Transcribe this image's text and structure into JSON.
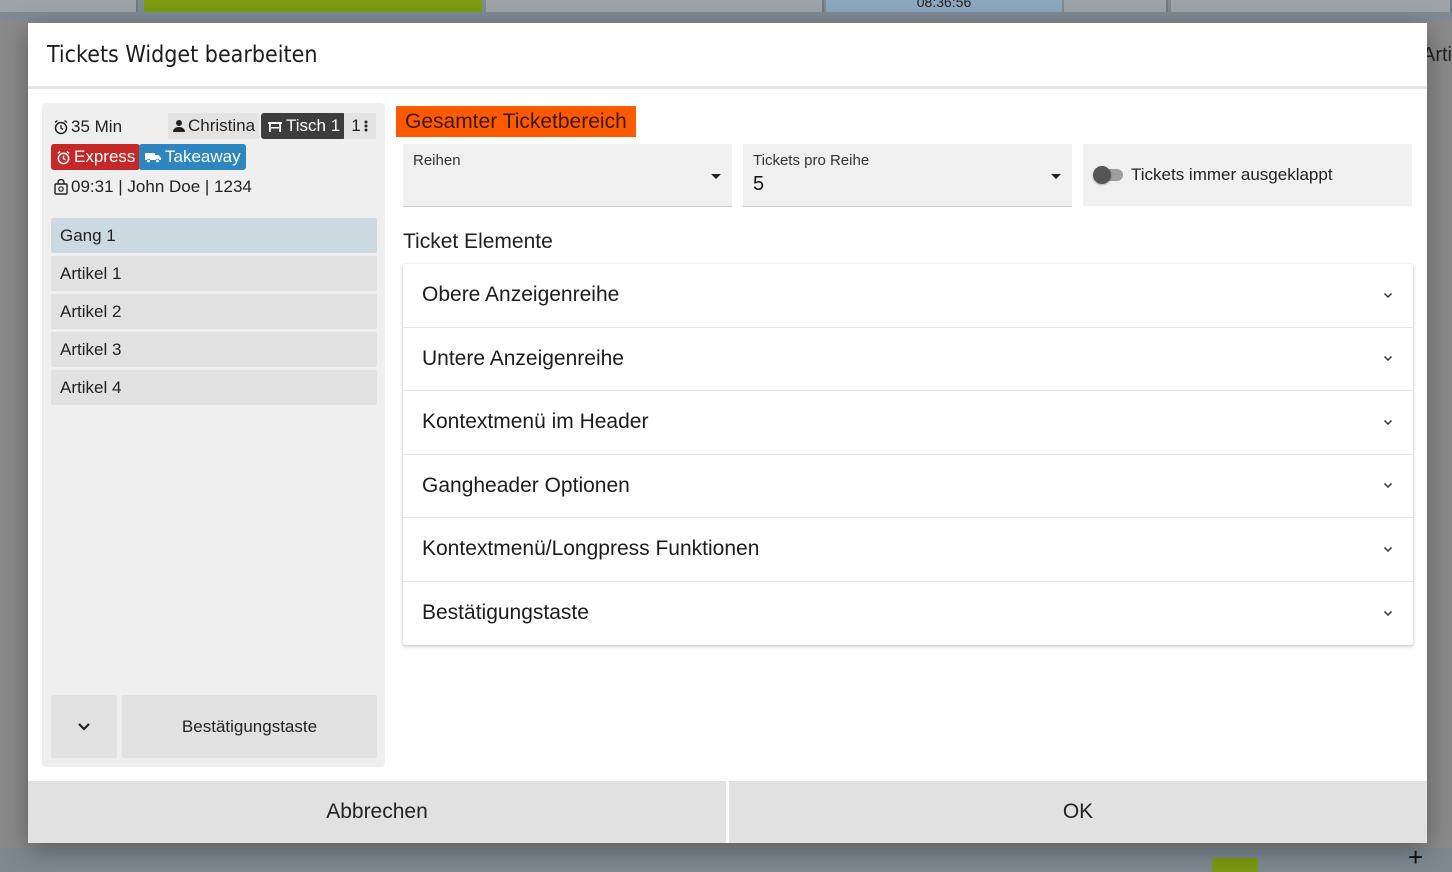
{
  "background": {
    "clock": "08:36:56",
    "right_label": "Arti",
    "plus": "+"
  },
  "dialog": {
    "title": "Tickets Widget bearbeiten"
  },
  "preview": {
    "timer": "35 Min",
    "user": "Christina",
    "table": "Tisch 1",
    "count": "1",
    "badge_express": "Express",
    "badge_takeaway": "Takeaway",
    "order_info": "09:31 | John Doe | 1234",
    "courses": [
      {
        "label": "Gang 1",
        "type": "head"
      },
      {
        "label": "Artikel 1",
        "type": "item"
      },
      {
        "label": "Artikel 2",
        "type": "item"
      },
      {
        "label": "Artikel 3",
        "type": "item"
      },
      {
        "label": "Artikel 4",
        "type": "item"
      }
    ],
    "confirm_button": "Bestätigungstaste"
  },
  "settings": {
    "section_tag": "Gesamter Ticketbereich",
    "rows_field": {
      "label": "Reihen",
      "value": ""
    },
    "per_row_field": {
      "label": "Tickets pro Reihe",
      "value": "5"
    },
    "toggle_label": "Tickets immer ausgeklappt",
    "toggle_on": false,
    "elements_title": "Ticket Elemente",
    "accordion": [
      "Obere Anzeigenreihe",
      "Untere Anzeigenreihe",
      "Kontextmenü im Header",
      "Gangheader Optionen",
      "Kontextmenü/Longpress Funktionen",
      "Bestätigungstaste"
    ]
  },
  "footer": {
    "cancel": "Abbrechen",
    "ok": "OK"
  },
  "colors": {
    "section_tag": "#ff5a00",
    "express": "#c62828",
    "takeaway": "#2e86c1",
    "table_chip": "#3d3d3d",
    "course_head": "#cdd9e0"
  }
}
